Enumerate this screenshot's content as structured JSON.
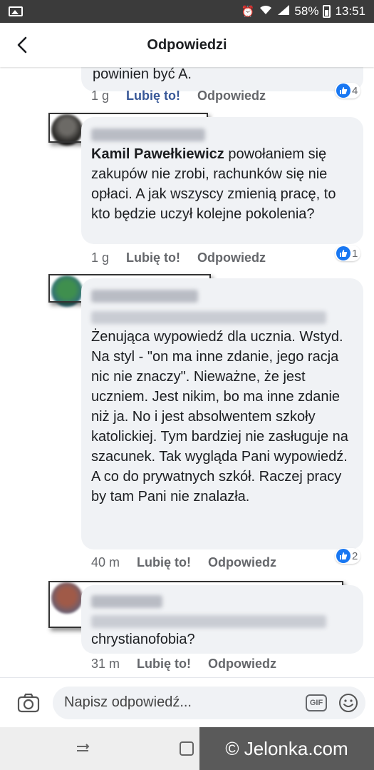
{
  "status_bar": {
    "battery": "58%",
    "time": "13:51"
  },
  "header": {
    "title": "Odpowiedzi",
    "back_icon": "arrow-left-icon"
  },
  "comments": [
    {
      "text": "powinien być A.",
      "time": "1 g",
      "like_label": "Lubię to!",
      "reply_label": "Odpowiedz",
      "reactions": "4",
      "liked": true
    },
    {
      "mention": "Kamil Pawełkiewicz",
      "text": "powołaniem się zakupów nie zrobi, rachunków się nie opłaci. A jak wszyscy zmienią pracę, to kto będzie uczył kolejne pokolenia?",
      "time": "1 g",
      "like_label": "Lubię to!",
      "reply_label": "Odpowiedz",
      "reactions": "1"
    },
    {
      "text": "Żenująca wypowiedź dla ucznia. Wstyd. Na styl - \"on ma inne zdanie, jego racja nic nie znaczy\". Nieważne, że jest uczniem. Jest nikim, bo ma inne zdanie niż ja. No i jest absolwentem szkoły katolickiej. Tym bardziej nie zasługuje na szacunek. Tak wygląda Pani wypowiedź. A co do prywatnych szkół. Raczej pracy by tam Pani nie znalazła.",
      "time": "40 m",
      "like_label": "Lubię to!",
      "reply_label": "Odpowiedz",
      "reactions": "2"
    },
    {
      "text": "chrystianofobia?",
      "time": "31 m",
      "like_label": "Lubię to!",
      "reply_label": "Odpowiedz"
    }
  ],
  "composer": {
    "placeholder": "Napisz odpowiedź...",
    "gif_label": "GIF"
  },
  "watermark": "© Jelonka.com",
  "colors": {
    "accent": "#1877f2",
    "liked": "#385898",
    "bubble": "#f0f2f5"
  }
}
